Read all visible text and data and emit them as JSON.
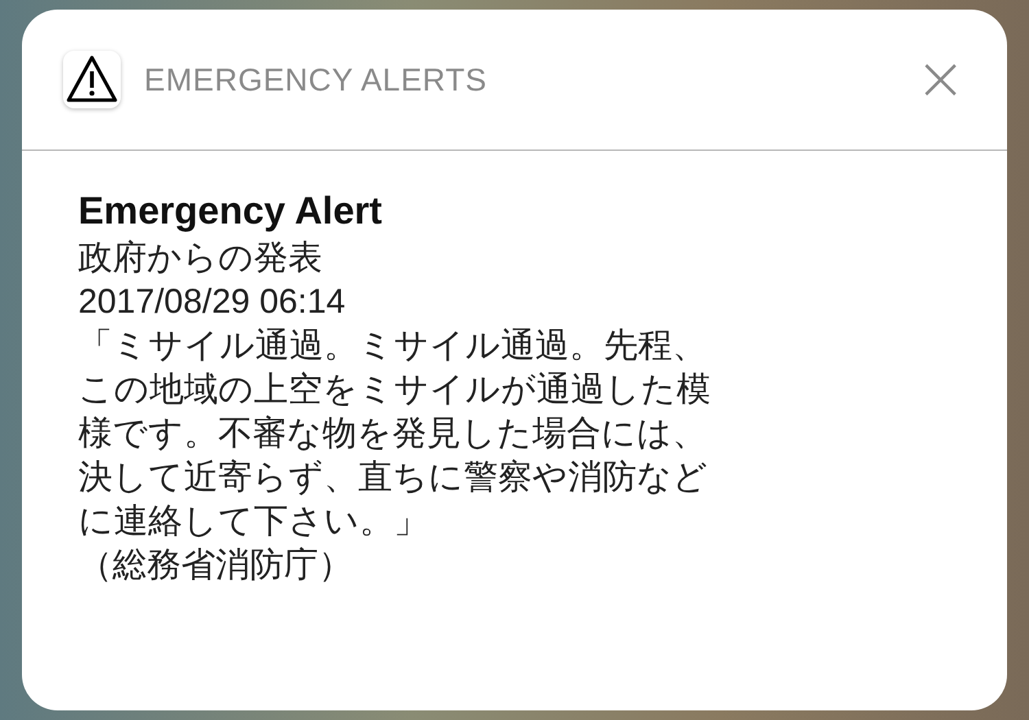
{
  "notification": {
    "app_name": "EMERGENCY ALERTS",
    "close": "×",
    "title": "Emergency Alert",
    "sender": "政府からの発表",
    "timestamp": "2017/08/29 06:14",
    "message_lines": [
      "「ミサイル通過。ミサイル通過。先程、",
      "この地域の上空をミサイルが通過した模",
      "様です。不審な物を発見した場合には、",
      "決して近寄らず、直ちに警察や消防など",
      "に連絡して下さい。」"
    ],
    "source": "（総務省消防庁）"
  }
}
